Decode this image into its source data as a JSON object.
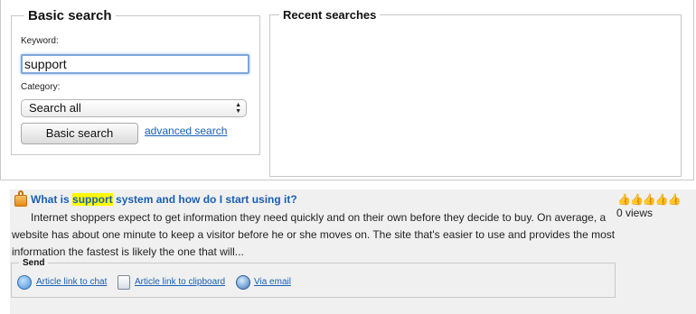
{
  "basic_search": {
    "legend": "Basic search",
    "keyword_label": "Keyword:",
    "keyword_value": "support",
    "category_label": "Category:",
    "category_selected": "Search all",
    "button_label": "Basic search",
    "advanced_link": "advanced search"
  },
  "recent_searches": {
    "legend": "Recent searches"
  },
  "result": {
    "title_before": "What is ",
    "title_highlight": "support",
    "title_after": " system and how do I start using it?",
    "description": "Internet shoppers expect to get information they need quickly and on their own before they decide to buy. On average, a website has about one minute to keep a visitor before he or she moves on. The site that's easier to use and provides the most information the fastest is likely the one that will...",
    "rating_icons": "👍👍👍👍👍",
    "views": "0 views",
    "send": {
      "legend": "Send",
      "chat": "Article link to chat",
      "clipboard": "Article link to clipboard",
      "email": "Via email"
    }
  }
}
